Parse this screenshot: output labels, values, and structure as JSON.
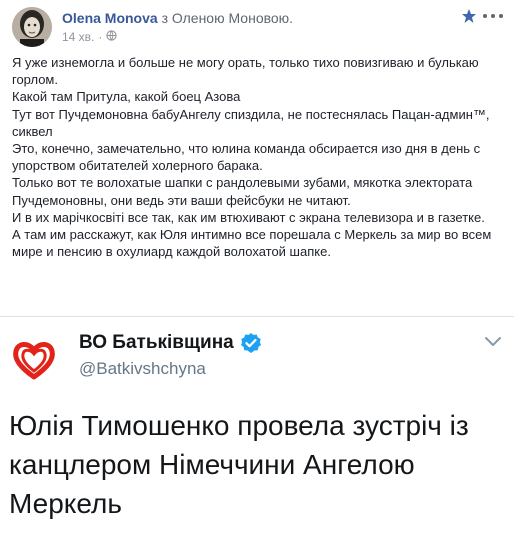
{
  "post": {
    "author": "Olena Monova",
    "with_text": "з Оленою Моновою.",
    "time": "14 хв.",
    "privacy_icon": "globe-icon",
    "lines": [
      "Я уже изнемогла и больше не могу орать, только тихо повизгиваю и булькаю горлом.",
      "Какой там Притула, какой боец Азова",
      "Тут вот Пучдемоновна бабуАнгелу спиздила, не постеснялась Пацан-админ™, сиквел",
      "Это, конечно, замечательно, что юлина команда обсирается изо дня в день с упорством обитателей холерного барака.",
      "Только вот те волохатые шапки с рандолевыми зубами, мякотка электората Пучдемоновны, они ведь эти ваши фейсбуки не читают.",
      "И в их марічкосвіті все так, как им втюхивают с экрана телевизора и в газетке.",
      "А там им расскажут, как Юля интимно все порешала с Меркель за мир во всем мире и пенсию в охулиард каждой волохатой шапке."
    ]
  },
  "embed": {
    "name": "ВО Батьківщина",
    "handle": "@Batkivshchyna",
    "text": "Юлія Тимошенко провела зустріч із канцлером Німеччини Ангелою Меркель",
    "logo_color": "#e2231a",
    "verified_color": "#1da1f2"
  }
}
